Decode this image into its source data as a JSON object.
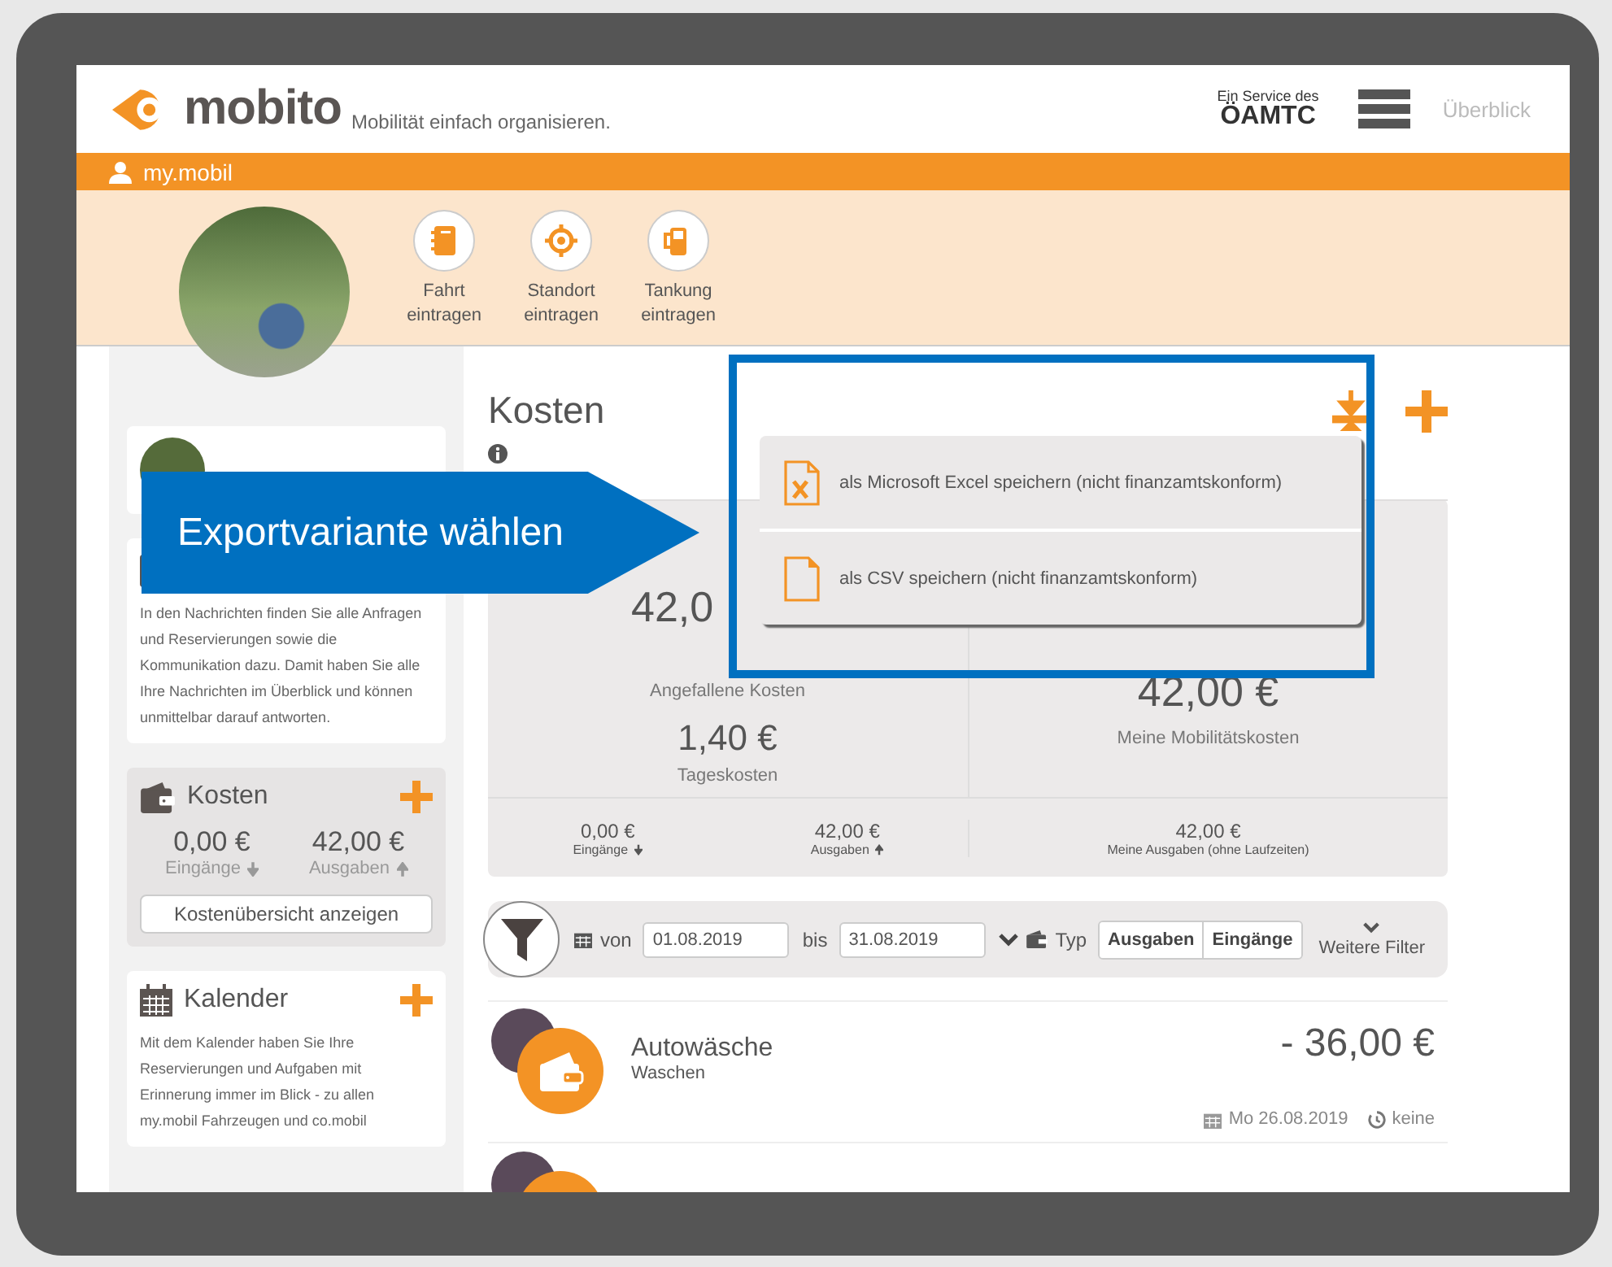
{
  "header": {
    "logo": "mobito",
    "tagline": "Mobilität einfach organisieren.",
    "service_label": "Ein Service des",
    "service_name": "ÖAMTC",
    "nav_link": "Überblick"
  },
  "user_bar": {
    "title": "my.mobil"
  },
  "quick_actions": [
    {
      "kind": "trip",
      "label": "Fahrt eintragen"
    },
    {
      "kind": "location",
      "label": "Standort eintragen"
    },
    {
      "kind": "fuel",
      "label": "Tankung eintragen"
    }
  ],
  "sidebar": {
    "messages": {
      "text": "In den Nachrichten finden Sie alle Anfragen und Reservierungen sowie die Kommunikation dazu. Damit haben Sie alle Ihre Nachrichten im Überblick und können unmittelbar darauf antworten."
    },
    "costs": {
      "title": "Kosten",
      "income": "0,00 €",
      "income_label": "Eingänge",
      "expenses": "42,00 €",
      "expenses_label": "Ausgaben",
      "button": "Kostenübersicht anzeigen"
    },
    "calendar": {
      "title": "Kalender",
      "text": "Mit dem Kalender haben Sie Ihre Reservierungen und Aufgaben mit Erinnerung immer im Blick - zu allen my.mobil Fahrzeugen und co.mobil"
    }
  },
  "costs_page": {
    "title": "Kosten",
    "stats": {
      "incurred": "42,0",
      "incurred_label": "Angefallene Kosten",
      "daily": "1,40 €",
      "daily_label": "Tageskosten",
      "mobility": "42,00 €",
      "mobility_label": "Meine Mobilitätskosten",
      "income": "0,00 €",
      "income_label": "Eingänge",
      "expenses": "42,00 €",
      "expenses_label": "Ausgaben",
      "my_expenses": "42,00 €",
      "my_expenses_label": "Meine Ausgaben (ohne Laufzeiten)"
    }
  },
  "filter": {
    "from_label": "von",
    "from": "01.08.2019",
    "to_label": "bis",
    "to": "31.08.2019",
    "type_label": "Typ",
    "types": [
      {
        "label": "Ausgaben",
        "selected": false
      },
      {
        "label": "Eingänge",
        "selected": false
      }
    ],
    "more": "Weitere Filter"
  },
  "entries": [
    {
      "title": "Autowäsche",
      "category": "Waschen",
      "amount": "- 36,00 €",
      "date": "Mo 26.08.2019",
      "repeat": "keine"
    }
  ],
  "export_menu": {
    "options": [
      {
        "kind": "excel",
        "label": "als Microsoft Excel speichern (nicht finanzamtskonform)"
      },
      {
        "kind": "csv",
        "label": "als CSV speichern (nicht finanzamtskonform)"
      }
    ]
  },
  "callout": {
    "text": "Exportvariante wählen"
  }
}
